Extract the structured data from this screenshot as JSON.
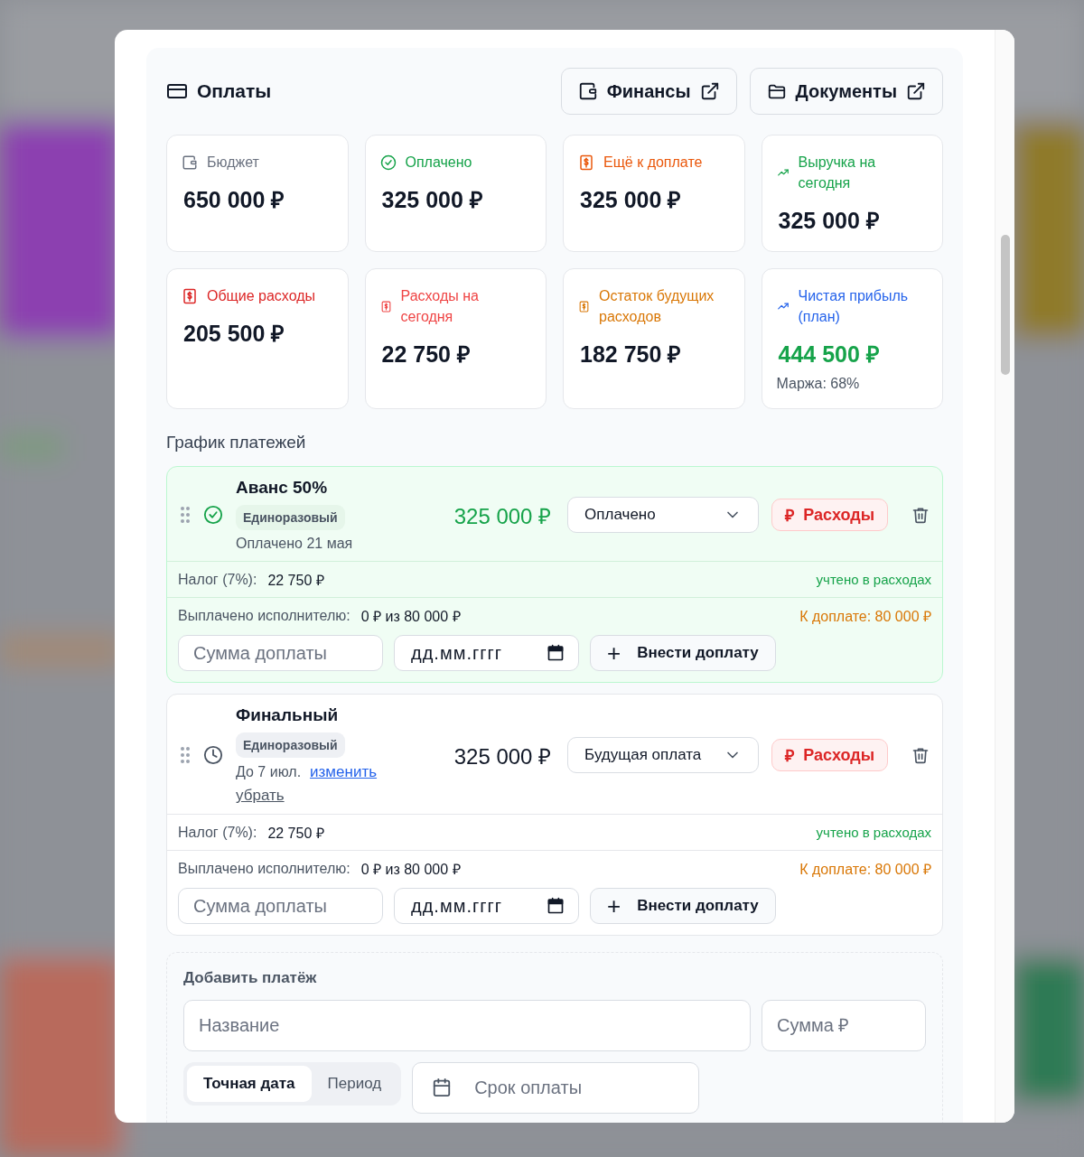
{
  "header": {
    "title": "Оплаты",
    "buttons": [
      {
        "label": "Финансы",
        "kind": "wallet"
      },
      {
        "label": "Документы",
        "kind": "folder"
      }
    ]
  },
  "stats": [
    {
      "label": "Бюджет",
      "value": "650 000 ₽",
      "kind": "wallet",
      "color": "#6b7280",
      "positive": false
    },
    {
      "label": "Оплачено",
      "value": "325 000 ₽",
      "kind": "check",
      "color": "#16a34a",
      "positive": false
    },
    {
      "label": "Ещё к доплате",
      "value": "325 000 ₽",
      "kind": "bill",
      "color": "#ea580c",
      "positive": false
    },
    {
      "label": "Выручка на сегодня",
      "value": "325 000 ₽",
      "kind": "trend",
      "color": "#16a34a",
      "positive": false
    },
    {
      "label": "Общие расходы",
      "value": "205 500 ₽",
      "kind": "bill",
      "color": "#dc2626",
      "positive": false
    },
    {
      "label": "Расходы на сегодня",
      "value": "22 750 ₽",
      "kind": "bill-small",
      "color": "#ef4444",
      "positive": false
    },
    {
      "label": "Остаток будущих расходов",
      "value": "182 750 ₽",
      "kind": "bill-small",
      "color": "#d97706",
      "positive": false
    },
    {
      "label": "Чистая прибыль (план)",
      "value": "444 500 ₽",
      "kind": "trend",
      "color": "#2563eb",
      "positive": true,
      "note": "Маржа: 68%"
    }
  ],
  "schedule": {
    "title": "График платежей",
    "payments": [
      {
        "title": "Аванс 50%",
        "badge": "Единоразовый",
        "paid": true,
        "date": "Оплачено 21 мая",
        "amount": "325 000 ₽",
        "status": "Оплачено",
        "expense_symbol": "₽",
        "expense_label": "Расходы",
        "tax_label": "Налог (7%):",
        "tax_value": "22 750 ₽",
        "tax_note": "учтено в расходах",
        "paid_label": "Выплачено исполнителю:",
        "paid_value": "0 ₽ из 80 000 ₽",
        "due": "К доплате: 80 000 ₽",
        "sum_placeholder": "Сумма доплаты",
        "date_placeholder": "дд.мм.гггг",
        "add_symbol": "+",
        "add_label": "Внести доплату"
      },
      {
        "title": "Финальный",
        "badge": "Единоразовый",
        "paid": false,
        "date": "До 7 июл.",
        "change_link": "изменить",
        "remove_link": "убрать",
        "amount": "325 000 ₽",
        "status": "Будущая оплата",
        "expense_symbol": "₽",
        "expense_label": "Расходы",
        "tax_label": "Налог (7%):",
        "tax_value": "22 750 ₽",
        "tax_note": "учтено в расходах",
        "paid_label": "Выплачено исполнителю:",
        "paid_value": "0 ₽ из 80 000 ₽",
        "due": "К доплате: 80 000 ₽",
        "sum_placeholder": "Сумма доплаты",
        "date_placeholder": "дд.мм.гггг",
        "add_symbol": "+",
        "add_label": "Внести доплату"
      }
    ]
  },
  "add_payment": {
    "title": "Добавить платёж",
    "name_placeholder": "Название",
    "sum_placeholder": "Сумма ₽",
    "modes": [
      {
        "label": "Точная дата",
        "selected": true
      },
      {
        "label": "Период",
        "selected": false
      }
    ],
    "date_placeholder": "Срок оплаты"
  }
}
